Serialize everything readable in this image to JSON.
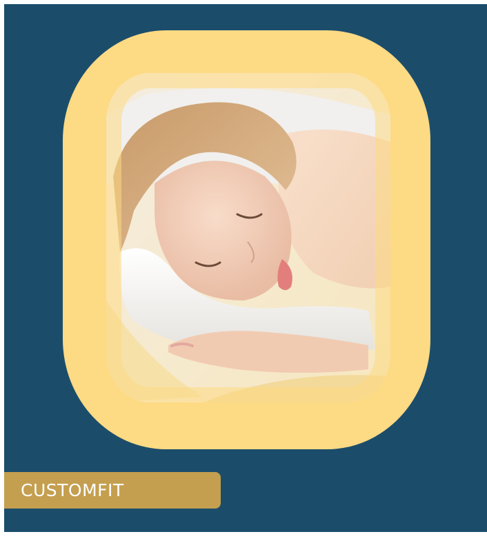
{
  "card": {
    "background_color": "#1b4d6b",
    "frame_color": "#fdda84",
    "tab_color": "#c49f4f"
  },
  "photo": {
    "icon": "sleeping-woman-photo"
  },
  "label": {
    "text": "CUSTOMFIT"
  }
}
